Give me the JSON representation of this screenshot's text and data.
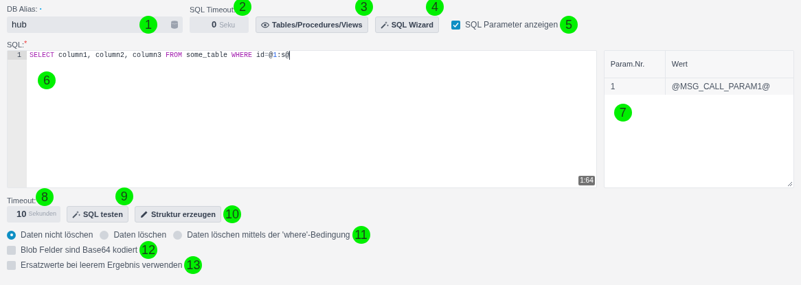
{
  "db_alias": {
    "label": "DB Alias:",
    "required_mark": "•",
    "value": "hub"
  },
  "sql_timeout": {
    "label": "SQL Timeout:",
    "value": "0",
    "unit": "Seku"
  },
  "toolbar_buttons": [
    "Tables/Procedures/Views",
    "SQL Wizard"
  ],
  "show_params": {
    "label": "SQL Parameter anzeigen",
    "checked": true
  },
  "sql": {
    "label": "SQL:",
    "required_mark": "*",
    "line_number": "1",
    "tokens": [
      {
        "kind": "keyword",
        "text": "SELECT"
      },
      {
        "kind": "plain",
        "text": " column1, column2, column3 "
      },
      {
        "kind": "keyword",
        "text": "FROM"
      },
      {
        "kind": "plain",
        "text": " some_table "
      },
      {
        "kind": "keyword",
        "text": "WHERE"
      },
      {
        "kind": "plain",
        "text": " id"
      },
      {
        "kind": "operator",
        "text": "="
      },
      {
        "kind": "plain",
        "text": "@"
      },
      {
        "kind": "number",
        "text": "1"
      },
      {
        "kind": "plain",
        "text": ":s@"
      }
    ],
    "cursor": "1:64"
  },
  "param_table": {
    "columns": [
      "Param.Nr.",
      "Wert"
    ],
    "rows": [
      [
        "1",
        "@MSG_CALL_PARAM1@"
      ]
    ]
  },
  "timeout": {
    "label": "Timeout:",
    "value": "10",
    "unit": "Sekunden"
  },
  "action_buttons": [
    "SQL testen",
    "Struktur erzeugen"
  ],
  "delete_options": [
    {
      "label": "Daten nicht löschen",
      "selected": true
    },
    {
      "label": "Daten löschen",
      "selected": false
    },
    {
      "label": "Daten löschen mittels der 'where'-Bedingung",
      "selected": false
    }
  ],
  "checkboxes": [
    {
      "label": "Blob Felder sind Base64 kodiert",
      "checked": false
    },
    {
      "label": "Ersatzwerte bei leerem Ergebnis verwenden",
      "checked": false
    }
  ],
  "callouts": [
    "1",
    "2",
    "3",
    "4",
    "5",
    "6",
    "7",
    "8",
    "9",
    "10",
    "11",
    "12",
    "13"
  ]
}
